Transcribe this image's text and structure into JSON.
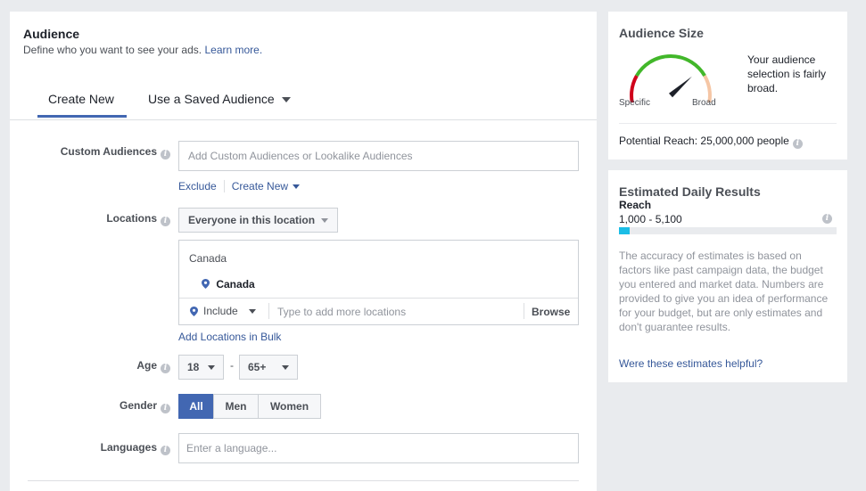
{
  "audience": {
    "title": "Audience",
    "subtitle": "Define who you want to see your ads.",
    "learn_more": "Learn more."
  },
  "tabs": [
    {
      "label": "Create New",
      "active": true
    },
    {
      "label": "Use a Saved Audience",
      "active": false
    }
  ],
  "custom_audiences": {
    "label": "Custom Audiences",
    "placeholder": "Add Custom Audiences or Lookalike Audiences",
    "exclude": "Exclude",
    "create_new": "Create New"
  },
  "locations": {
    "label": "Locations",
    "dropdown": "Everyone in this location",
    "group_heading": "Canada",
    "selected": "Canada",
    "include": "Include",
    "placeholder": "Type to add more locations",
    "browse": "Browse",
    "bulk": "Add Locations in Bulk"
  },
  "age": {
    "label": "Age",
    "min": "18",
    "separator": "-",
    "max": "65+"
  },
  "gender": {
    "label": "Gender",
    "options": [
      "All",
      "Men",
      "Women"
    ],
    "selected": "All"
  },
  "languages": {
    "label": "Languages",
    "placeholder": "Enter a language..."
  },
  "audience_size": {
    "title": "Audience Size",
    "specific": "Specific",
    "broad": "Broad",
    "description": "Your audience selection is fairly broad.",
    "potential_reach": "Potential Reach: 25,000,000 people",
    "gauge_level": 0.72,
    "colors": {
      "specific": "#d0021b",
      "middle": "#42b72a",
      "broad": "#f5c6a5",
      "needle": "#1d2129"
    }
  },
  "daily_results": {
    "title": "Estimated Daily Results",
    "metric": "Reach",
    "range": "1,000 - 5,100",
    "progress": 0.05,
    "accuracy": "The accuracy of estimates is based on factors like past campaign data, the budget you entered and market data. Numbers are provided to give you an idea of performance for your budget, but are only estimates and don't guarantee results.",
    "helpful": "Were these estimates helpful?"
  },
  "colors": {
    "accent": "#4267b2",
    "link": "#365899",
    "progress": "#1bbde6"
  }
}
